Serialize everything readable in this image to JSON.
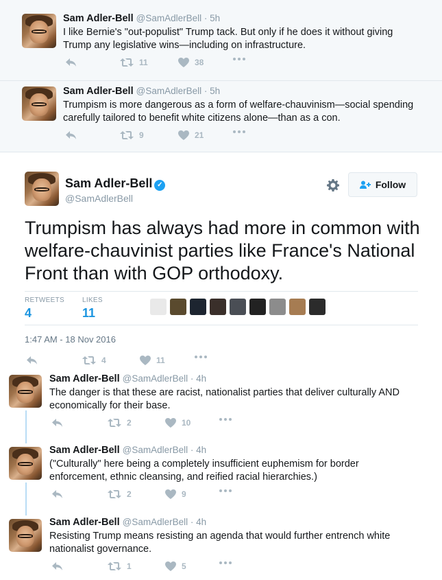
{
  "context_tweets": [
    {
      "name": "Sam Adler-Bell",
      "meta": "@SamAdlerBell · 5h",
      "text_lines": [
        "I like Bernie's \"out-populist\" Trump tack. But only if he does it without giving",
        "Trump any legislative wins—including on infrastructure."
      ],
      "retweets": "11",
      "likes": "38"
    },
    {
      "name": "Sam Adler-Bell",
      "meta": "@SamAdlerBell · 5h",
      "text_lines": [
        "Trumpism is more dangerous as a form of welfare-chauvinism—social spending",
        "carefully tailored to benefit white citizens alone—than as a con."
      ],
      "retweets": "9",
      "likes": "21"
    }
  ],
  "main_tweet": {
    "name": "Sam Adler-Bell",
    "handle": "@SamAdlerBell",
    "follow_label": "Follow",
    "text_lines": [
      "Trumpism has always had more in common with",
      "welfare-chauvinist parties like France's National",
      "Front than with GOP orthodoxy."
    ],
    "retweets_label": "RETWEETS",
    "retweets": "4",
    "likes_label": "LIKES",
    "likes": "11",
    "timestamp": "1:47 AM - 18 Nov 2016",
    "action_retweets": "4",
    "action_likes": "11",
    "liker_colors": [
      "#e9e9e9",
      "#5a4a2e",
      "#1d2530",
      "#3a2f2a",
      "#4a4e55",
      "#222222",
      "#8c8c8c",
      "#a67c52",
      "#2b2b2b"
    ]
  },
  "replies": [
    {
      "name": "Sam Adler-Bell",
      "meta": "@SamAdlerBell · 4h",
      "text_lines": [
        "The danger is that these are racist, nationalist parties that deliver culturally AND",
        "economically for their base."
      ],
      "retweets": "2",
      "likes": "10"
    },
    {
      "name": "Sam Adler-Bell",
      "meta": "@SamAdlerBell · 4h",
      "text_lines": [
        "(\"Culturally\" here being a completely insufficient euphemism for border",
        "enforcement, ethnic cleansing, and reified racial hierarchies.)"
      ],
      "retweets": "2",
      "likes": "9"
    },
    {
      "name": "Sam Adler-Bell",
      "meta": "@SamAdlerBell · 4h",
      "text_lines": [
        "Resisting Trump means resisting an agenda that would further entrench white",
        "nationalist governance."
      ],
      "retweets": "1",
      "likes": "5"
    }
  ],
  "colors": {
    "accent": "#1da1f2",
    "stat_value": "#1b95e0",
    "muted": "#8899a6",
    "icon": "#aab8c2",
    "thread_line": "#b9dcf5"
  }
}
